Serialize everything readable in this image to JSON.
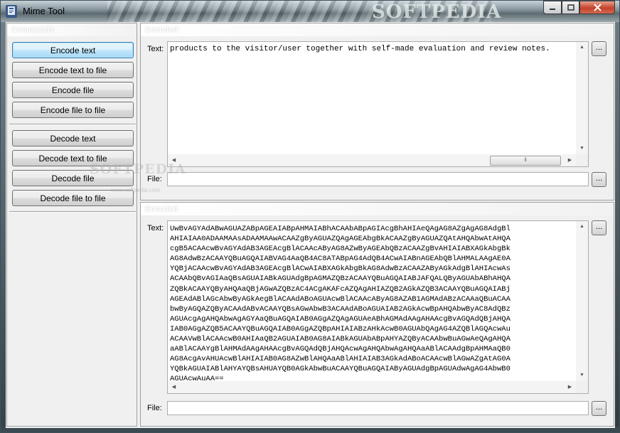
{
  "window": {
    "title": "Mime Tool",
    "icon_label": "tool-icon",
    "watermark": "SOFTPEDIA",
    "controls": {
      "minimize": "—",
      "maximize": "□",
      "close": "✕"
    }
  },
  "commands": {
    "header": "Commands",
    "encode": [
      "Encode text",
      "Encode text to file",
      "Encode file",
      "Encode file to file"
    ],
    "decode": [
      "Decode text",
      "Decode text to file",
      "Decode file",
      "Decode file to file"
    ]
  },
  "decoded": {
    "header": "Decoded",
    "text_label": "Text:",
    "text_value": "products to the visitor/user together with self-made evaluation and review notes.",
    "file_label": "File:",
    "browse_label": "..."
  },
  "encoded": {
    "header": "Encoded",
    "text_label": "Text:",
    "lines": [
      "UwBvAGYAdABwAGUAZABpAGEAIABpAHMAIABhACAAbABpAGIAcgBhAHIAeQAgAG8AZgAgAG8AdgBl",
      "AHIAIAA0ADAAMAAsADAAMAAwACAAZgByAGUAZQAgAGEAbgBkACAAZgByAGUAZQAtAHQAbwAtAHQA",
      "cgB5ACAAcwBvAGYAdAB3AGEAcgBlACAAcAByAG8AZwByAGEAbQBzACAAZgBvAHIAIABXAGkAbgBk",
      "AG8AdwBzACAAYQBuAGQAIABVAG4AaQB4AC8ATABpAG4AdQB4ACwAIABnAGEAbQBlAHMALAAgAE0A",
      "YQBjACAAcwBvAGYAdAB3AGEAcgBlACwAIABXAGkAbgBkAG8AdwBzACAAZAByAGkAdgBlAHIAcwAs",
      "ACAAbQBvAGIAaQBsAGUAIABkAGUAdgBpAGMAZQBzACAAYQBuAGQAIABJAFQALQByAGUAbABhAHQA",
      "ZQBkACAAYQByAHQAaQBjAGwAZQBzAC4ACgAKAFcAZQAgAHIAZQB2AGkAZQB3ACAAYQBuAGQAIABj",
      "AGEAdABlAGcAbwByAGkAegBlACAAdABoAGUAcwBlACAAcAByAG8AZAB1AGMAdABzACAAaQBuACAA",
      "bwByAGQAZQByACAAdABvACAAYQBsAGwAbwB3ACAAdABoAGUAIAB2AGkAcwBpAHQAbwByAC8AdQBz",
      "AGUAcgAgAHQAbwAgAGYAaQBuAGQAIAB0AGgAZQAgAGUAeABhAGMAdAAgAHAAcgBvAGQAdQBjAHQA",
      "IAB0AGgAZQB5ACAAYQBuAGQAIAB0AGgAZQBpAHIAIABzAHkAcwB0AGUAbQAgAG4AZQBlAGQAcwAu",
      "ACAAVwBlACAAcwB0AHIAaQB2AGUAIAB0AG8AIABkAGUAbABpAHYAZQByACAAbwBuAGwAeQAgAHQA",
      "aABlACAAYgBlAHMAdAAgAHAAcgBvAGQAdQBjAHQAcwAgAHQAbwAgAHQAaABlACAAdgBpAHMAaQB0",
      "AG8AcgAvAHUAcwBlAHIAIAB0AG8AZwBlAHQAaABlAHIAIAB3AGkAdABoACAAcwBlAGwAZgAtAG0A",
      "YQBkAGUAIABlAHYAYQBsAHUAYQB0AGkAbwBuACAAYQBuAGQAIAByAGUAdgBpAGUAdwAgAG4AbwB0",
      "AGUAcwAuAA=="
    ],
    "file_label": "File:",
    "browse_label": "..."
  },
  "scroll": {
    "up": "▲",
    "down": "▼",
    "left": "◀",
    "right": "▶",
    "grip": "⦀"
  },
  "bg_watermark": {
    "big": "SOFTPEDIA",
    "small": "www.softpedia.com"
  }
}
